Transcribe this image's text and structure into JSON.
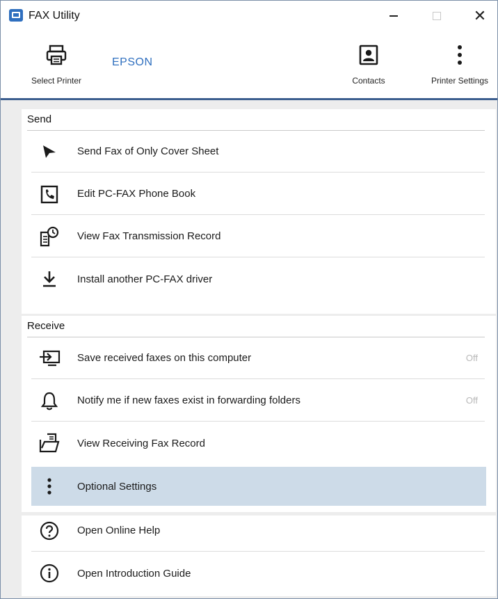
{
  "window": {
    "title": "FAX Utility",
    "controls": {
      "minimize": "—",
      "maximize": "□",
      "close": "✕"
    }
  },
  "toolbar": {
    "select_printer_label": "Select Printer",
    "printer_name": "EPSON",
    "contacts_label": "Contacts",
    "printer_settings_label": "Printer Settings"
  },
  "send": {
    "header": "Send",
    "items": [
      {
        "label": "Send Fax of Only Cover Sheet",
        "icon": "send-arrow-icon"
      },
      {
        "label": "Edit PC-FAX Phone Book",
        "icon": "phone-book-icon"
      },
      {
        "label": "View Fax Transmission Record",
        "icon": "transmission-record-icon"
      },
      {
        "label": "Install another PC-FAX driver",
        "icon": "download-install-icon"
      }
    ]
  },
  "receive": {
    "header": "Receive",
    "items": [
      {
        "label": "Save received faxes on this computer",
        "status": "Off",
        "icon": "save-to-computer-icon"
      },
      {
        "label": "Notify me if new faxes exist in forwarding folders",
        "status": "Off",
        "icon": "bell-icon"
      },
      {
        "label": "View Receiving Fax Record",
        "icon": "receiving-record-icon"
      }
    ]
  },
  "misc": {
    "items": [
      {
        "label": "Optional Settings",
        "icon": "more-vertical-icon",
        "selected": true
      },
      {
        "label": "Open Online Help",
        "icon": "help-icon"
      },
      {
        "label": "Open Introduction Guide",
        "icon": "info-icon"
      }
    ]
  },
  "colors": {
    "accent": "#2f6fbf",
    "selected_row": "#cddbe8",
    "toolbar_divider": "#3d5f8f"
  }
}
